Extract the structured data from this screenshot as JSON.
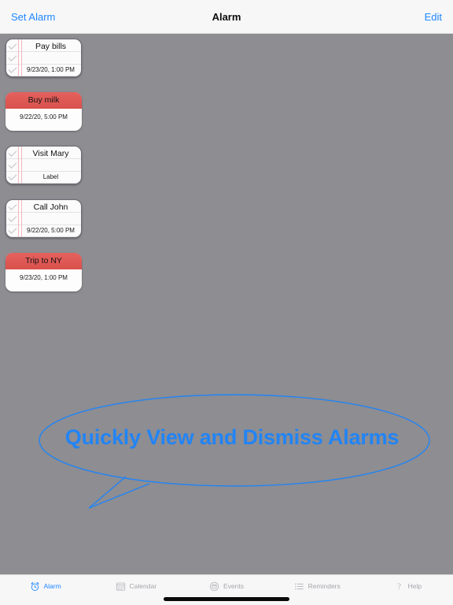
{
  "navbar": {
    "left_button": "Set Alarm",
    "title": "Alarm",
    "right_button": "Edit"
  },
  "alarms": [
    {
      "style": "note",
      "title": "Pay bills",
      "subtitle": "9/23/20, 1:00 PM"
    },
    {
      "style": "flat",
      "title": "Buy milk",
      "subtitle": "9/22/20, 5:00 PM"
    },
    {
      "style": "note",
      "title": "Visit Mary",
      "subtitle": "Label"
    },
    {
      "style": "note",
      "title": "Call John",
      "subtitle": "9/22/20, 5:00 PM"
    },
    {
      "style": "flat",
      "title": "Trip to NY",
      "subtitle": "9/23/20, 1:00 PM"
    }
  ],
  "callout": {
    "text": "Quickly View and Dismiss Alarms",
    "color": "#2284f5"
  },
  "tabbar": {
    "items": [
      {
        "label": "Alarm",
        "icon": "alarm-clock-icon",
        "active": true
      },
      {
        "label": "Calendar",
        "icon": "calendar-icon",
        "active": false
      },
      {
        "label": "Events",
        "icon": "events-icon",
        "active": false
      },
      {
        "label": "Reminders",
        "icon": "list-icon",
        "active": false
      },
      {
        "label": "Help",
        "icon": "question-mark-icon",
        "active": false
      }
    ]
  },
  "colors": {
    "background": "#8d8d92",
    "accent": "#1f87ff",
    "alarm_header_red": "#d9504c",
    "tabbar_background": "#f7f7f8",
    "inactive_tab": "#a6a6ab"
  }
}
